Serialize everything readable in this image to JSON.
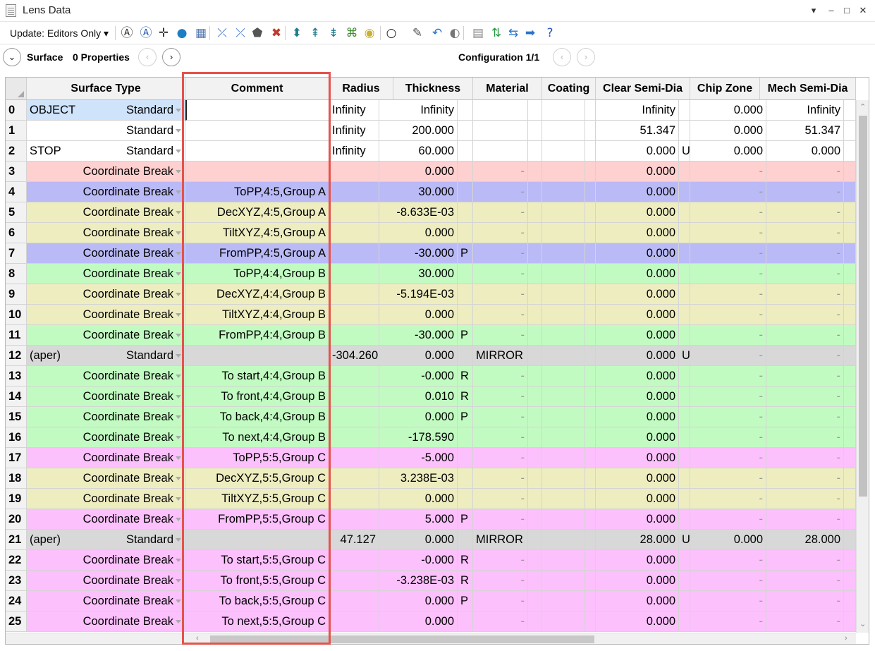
{
  "window": {
    "title": "Lens Data",
    "controls": [
      "▾",
      "–",
      "□",
      "✕"
    ]
  },
  "toolbar": {
    "update_label": "Update: Editors Only ▾",
    "icons": [
      "refresh-1-icon",
      "refresh-all-icon",
      "crosshair-icon",
      "globe-icon",
      "map-icon",
      "tilt-icon",
      "decenter-icon",
      "glass-icon",
      "delete-glass-icon",
      "lens-icon",
      "surface-icon",
      "element-icon",
      "apple-icon",
      "color-icon",
      "ring-icon",
      "pencil-icon",
      "undo-icon",
      "toggle-icon",
      "sheet-icon",
      "swap-icon",
      "compress-icon",
      "arrow-right-icon",
      "help-icon"
    ]
  },
  "navbar": {
    "surface_label": "Surface",
    "properties_label": "0 Properties",
    "configuration_label": "Configuration 1/1"
  },
  "grid": {
    "columns": [
      "Surface Type",
      "Comment",
      "Radius",
      "Thickness",
      "Material",
      "Coating",
      "Clear Semi-Dia",
      "Chip Zone",
      "Mech Semi-Dia"
    ],
    "rows": [
      {
        "n": "0",
        "pre": "OBJECT",
        "type": "Standard",
        "comment": "",
        "radius": "Infinity",
        "thick": "Infinity",
        "tflag": "",
        "mat": "",
        "coat": "",
        "clear": "Infinity",
        "cflag": "",
        "chip": "0.000",
        "mech": "Infinity",
        "color": "#ffffff"
      },
      {
        "n": "1",
        "pre": "",
        "type": "Standard",
        "comment": "",
        "radius": "Infinity",
        "thick": "200.000",
        "tflag": "",
        "mat": "",
        "coat": "",
        "clear": "51.347",
        "cflag": "",
        "chip": "0.000",
        "mech": "51.347",
        "color": "#ffffff"
      },
      {
        "n": "2",
        "pre": "STOP",
        "type": "Standard",
        "comment": "",
        "radius": "Infinity",
        "thick": "60.000",
        "tflag": "",
        "mat": "",
        "coat": "",
        "clear": "0.000",
        "cflag": "U",
        "chip": "0.000",
        "mech": "0.000",
        "color": "#ffffff"
      },
      {
        "n": "3",
        "pre": "",
        "type": "Coordinate Break",
        "comment": "",
        "radius": "",
        "thick": "0.000",
        "tflag": "",
        "mat": "-",
        "coat": "",
        "clear": "0.000",
        "cflag": "",
        "chip": "-",
        "mech": "-",
        "color": "#ffd0d0"
      },
      {
        "n": "4",
        "pre": "",
        "type": "Coordinate Break",
        "comment": "ToPP,4:5,Group A",
        "radius": "",
        "thick": "30.000",
        "tflag": "",
        "mat": "-",
        "coat": "",
        "clear": "0.000",
        "cflag": "",
        "chip": "-",
        "mech": "-",
        "color": "#babaf7"
      },
      {
        "n": "5",
        "pre": "",
        "type": "Coordinate Break",
        "comment": "DecXYZ,4:5,Group A",
        "radius": "",
        "thick": "-8.633E-03",
        "tflag": "",
        "mat": "-",
        "coat": "",
        "clear": "0.000",
        "cflag": "",
        "chip": "-",
        "mech": "-",
        "color": "#ededc0"
      },
      {
        "n": "6",
        "pre": "",
        "type": "Coordinate Break",
        "comment": "TiltXYZ,4:5,Group A",
        "radius": "",
        "thick": "0.000",
        "tflag": "",
        "mat": "-",
        "coat": "",
        "clear": "0.000",
        "cflag": "",
        "chip": "-",
        "mech": "-",
        "color": "#ededc0"
      },
      {
        "n": "7",
        "pre": "",
        "type": "Coordinate Break",
        "comment": "FromPP,4:5,Group A",
        "radius": "",
        "thick": "-30.000",
        "tflag": "P",
        "mat": "-",
        "coat": "",
        "clear": "0.000",
        "cflag": "",
        "chip": "-",
        "mech": "-",
        "color": "#babaf7"
      },
      {
        "n": "8",
        "pre": "",
        "type": "Coordinate Break",
        "comment": "ToPP,4:4,Group B",
        "radius": "",
        "thick": "30.000",
        "tflag": "",
        "mat": "-",
        "coat": "",
        "clear": "0.000",
        "cflag": "",
        "chip": "-",
        "mech": "-",
        "color": "#c2fbc2"
      },
      {
        "n": "9",
        "pre": "",
        "type": "Coordinate Break",
        "comment": "DecXYZ,4:4,Group B",
        "radius": "",
        "thick": "-5.194E-03",
        "tflag": "",
        "mat": "-",
        "coat": "",
        "clear": "0.000",
        "cflag": "",
        "chip": "-",
        "mech": "-",
        "color": "#ededc0"
      },
      {
        "n": "10",
        "pre": "",
        "type": "Coordinate Break",
        "comment": "TiltXYZ,4:4,Group B",
        "radius": "",
        "thick": "0.000",
        "tflag": "",
        "mat": "-",
        "coat": "",
        "clear": "0.000",
        "cflag": "",
        "chip": "-",
        "mech": "-",
        "color": "#ededc0"
      },
      {
        "n": "11",
        "pre": "",
        "type": "Coordinate Break",
        "comment": "FromPP,4:4,Group B",
        "radius": "",
        "thick": "-30.000",
        "tflag": "P",
        "mat": "-",
        "coat": "",
        "clear": "0.000",
        "cflag": "",
        "chip": "-",
        "mech": "-",
        "color": "#c2fbc2"
      },
      {
        "n": "12",
        "pre": "(aper)",
        "type": "Standard",
        "comment": "",
        "radius": "-304.260",
        "thick": "0.000",
        "tflag": "",
        "mat": "MIRROR",
        "coat": "",
        "clear": "0.000",
        "cflag": "U",
        "chip": "-",
        "mech": "-",
        "color": "#d8d8d8"
      },
      {
        "n": "13",
        "pre": "",
        "type": "Coordinate Break",
        "comment": "To start,4:4,Group B",
        "radius": "",
        "thick": "-0.000",
        "tflag": "R",
        "mat": "-",
        "coat": "",
        "clear": "0.000",
        "cflag": "",
        "chip": "-",
        "mech": "-",
        "color": "#c2fbc2"
      },
      {
        "n": "14",
        "pre": "",
        "type": "Coordinate Break",
        "comment": "To front,4:4,Group B",
        "radius": "",
        "thick": "0.010",
        "tflag": "R",
        "mat": "-",
        "coat": "",
        "clear": "0.000",
        "cflag": "",
        "chip": "-",
        "mech": "-",
        "color": "#c2fbc2"
      },
      {
        "n": "15",
        "pre": "",
        "type": "Coordinate Break",
        "comment": "To back,4:4,Group B",
        "radius": "",
        "thick": "0.000",
        "tflag": "P",
        "mat": "-",
        "coat": "",
        "clear": "0.000",
        "cflag": "",
        "chip": "-",
        "mech": "-",
        "color": "#c2fbc2"
      },
      {
        "n": "16",
        "pre": "",
        "type": "Coordinate Break",
        "comment": "To next,4:4,Group B",
        "radius": "",
        "thick": "-178.590",
        "tflag": "",
        "mat": "-",
        "coat": "",
        "clear": "0.000",
        "cflag": "",
        "chip": "-",
        "mech": "-",
        "color": "#c2fbc2"
      },
      {
        "n": "17",
        "pre": "",
        "type": "Coordinate Break",
        "comment": "ToPP,5:5,Group C",
        "radius": "",
        "thick": "-5.000",
        "tflag": "",
        "mat": "-",
        "coat": "",
        "clear": "0.000",
        "cflag": "",
        "chip": "-",
        "mech": "-",
        "color": "#fcc0fc"
      },
      {
        "n": "18",
        "pre": "",
        "type": "Coordinate Break",
        "comment": "DecXYZ,5:5,Group C",
        "radius": "",
        "thick": "3.238E-03",
        "tflag": "",
        "mat": "-",
        "coat": "",
        "clear": "0.000",
        "cflag": "",
        "chip": "-",
        "mech": "-",
        "color": "#ededc0"
      },
      {
        "n": "19",
        "pre": "",
        "type": "Coordinate Break",
        "comment": "TiltXYZ,5:5,Group C",
        "radius": "",
        "thick": "0.000",
        "tflag": "",
        "mat": "-",
        "coat": "",
        "clear": "0.000",
        "cflag": "",
        "chip": "-",
        "mech": "-",
        "color": "#ededc0"
      },
      {
        "n": "20",
        "pre": "",
        "type": "Coordinate Break",
        "comment": "FromPP,5:5,Group C",
        "radius": "",
        "thick": "5.000",
        "tflag": "P",
        "mat": "-",
        "coat": "",
        "clear": "0.000",
        "cflag": "",
        "chip": "-",
        "mech": "-",
        "color": "#fcc0fc"
      },
      {
        "n": "21",
        "pre": "(aper)",
        "type": "Standard",
        "comment": "",
        "radius": "47.127",
        "thick": "0.000",
        "tflag": "",
        "mat": "MIRROR",
        "coat": "",
        "clear": "28.000",
        "cflag": "U",
        "chip": "0.000",
        "mech": "28.000",
        "color": "#d8d8d8"
      },
      {
        "n": "22",
        "pre": "",
        "type": "Coordinate Break",
        "comment": "To start,5:5,Group C",
        "radius": "",
        "thick": "-0.000",
        "tflag": "R",
        "mat": "-",
        "coat": "",
        "clear": "0.000",
        "cflag": "",
        "chip": "-",
        "mech": "-",
        "color": "#fcc0fc"
      },
      {
        "n": "23",
        "pre": "",
        "type": "Coordinate Break",
        "comment": "To front,5:5,Group C",
        "radius": "",
        "thick": "-3.238E-03",
        "tflag": "R",
        "mat": "-",
        "coat": "",
        "clear": "0.000",
        "cflag": "",
        "chip": "-",
        "mech": "-",
        "color": "#fcc0fc"
      },
      {
        "n": "24",
        "pre": "",
        "type": "Coordinate Break",
        "comment": "To back,5:5,Group C",
        "radius": "",
        "thick": "0.000",
        "tflag": "P",
        "mat": "-",
        "coat": "",
        "clear": "0.000",
        "cflag": "",
        "chip": "-",
        "mech": "-",
        "color": "#fcc0fc"
      },
      {
        "n": "25",
        "pre": "",
        "type": "Coordinate Break",
        "comment": "To next,5:5,Group C",
        "radius": "",
        "thick": "0.000",
        "tflag": "",
        "mat": "-",
        "coat": "",
        "clear": "0.000",
        "cflag": "",
        "chip": "-",
        "mech": "-",
        "color": "#fcc0fc"
      }
    ]
  },
  "annotation": {
    "highlight_color": "#e4534c"
  }
}
